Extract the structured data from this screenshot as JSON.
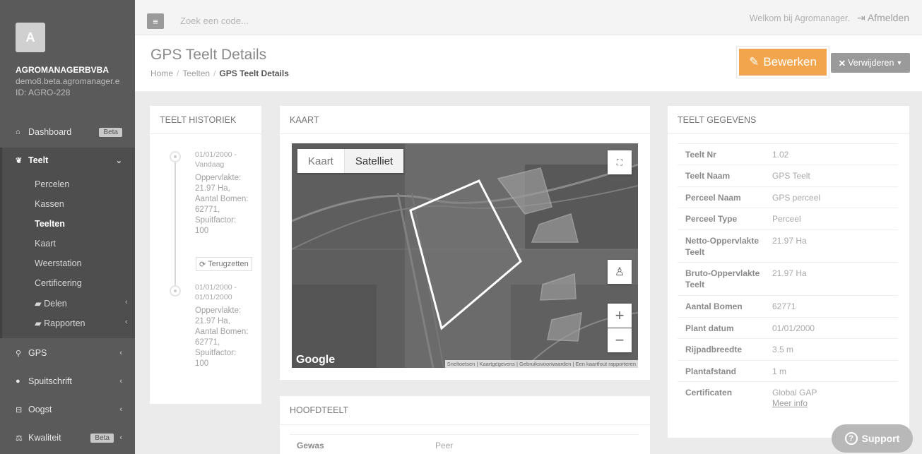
{
  "sidebar": {
    "avatar_letter": "A",
    "company_name": "AGROMANAGERBVBA",
    "company_email": "demo8.beta.agromanager.e",
    "company_id": "ID: AGRO-228",
    "items": [
      {
        "label": "Dashboard",
        "icon": "home-icon",
        "badge": "Beta"
      },
      {
        "label": "Teelt",
        "icon": "leaf-icon"
      },
      {
        "label": "GPS",
        "icon": "map-marker-icon"
      },
      {
        "label": "Spuitschrift",
        "icon": "drop-icon"
      },
      {
        "label": "Oogst",
        "icon": "basket-icon"
      },
      {
        "label": "Kwaliteit",
        "icon": "scale-icon",
        "badge": "Beta"
      }
    ],
    "teelt_sub": [
      "Percelen",
      "Kassen",
      "Teelten",
      "Kaart",
      "Weerstation",
      "Certificering",
      "Delen",
      "Rapporten"
    ]
  },
  "topbar": {
    "search_placeholder": "Zoek een code...",
    "welcome": "Welkom bij Agromanager.",
    "logout": "Afmelden"
  },
  "header": {
    "title": "GPS Teelt Details",
    "breadcrumb": [
      "Home",
      "Teelten",
      "GPS Teelt Details"
    ],
    "edit_label": "Bewerken",
    "delete_label": "Verwijderen"
  },
  "historiek": {
    "title": "TEELT HISTORIEK",
    "entries": [
      {
        "date": "01/01/2000 - Vandaag",
        "text": "Oppervlakte: 21.97 Ha, Aantal Bomen: 62771, Spuitfactor: 100"
      },
      {
        "date": "01/01/2000 - 01/01/2000",
        "text": "Oppervlakte: 21.97 Ha, Aantal Bomen: 62771, Spuitfactor: 100"
      }
    ],
    "restore_label": "Terugzetten"
  },
  "kaart": {
    "title": "KAART",
    "type_map": "Kaart",
    "type_sat": "Satelliet",
    "logo": "Google",
    "footer": "Sneltoetsen | Kaartgegevens | Gebruiksvoorwaarden | Een kaartfout rapporteren"
  },
  "hoofdteelt": {
    "title": "HOOFDTEELT",
    "gewas_label": "Gewas",
    "gewas_value": "Peer"
  },
  "gegevens": {
    "title": "TEELT GEGEVENS",
    "rows": [
      {
        "k": "Teelt Nr",
        "v": "1.02"
      },
      {
        "k": "Teelt Naam",
        "v": "GPS Teelt"
      },
      {
        "k": "Perceel Naam",
        "v": "GPS perceel"
      },
      {
        "k": "Perceel Type",
        "v": "Perceel"
      },
      {
        "k": "Netto-Oppervlakte Teelt",
        "v": "21.97 Ha"
      },
      {
        "k": "Bruto-Oppervlakte Teelt",
        "v": "21.97 Ha"
      },
      {
        "k": "Aantal Bomen",
        "v": "62771"
      },
      {
        "k": "Plant datum",
        "v": "01/01/2000"
      },
      {
        "k": "Rijpadbreedte",
        "v": "3.5 m"
      },
      {
        "k": "Plantafstand",
        "v": "1 m"
      },
      {
        "k": "Certificaten",
        "v": "Global GAP",
        "link": "Meer info"
      }
    ]
  },
  "support_label": "Support"
}
